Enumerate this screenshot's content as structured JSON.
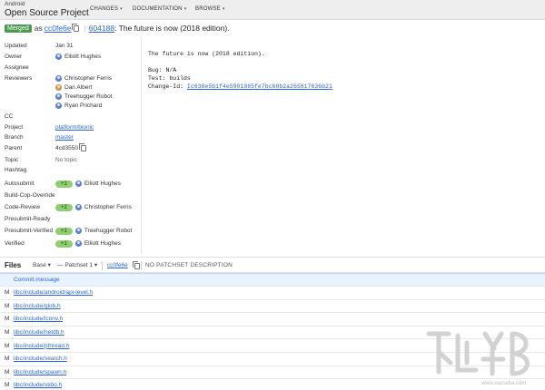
{
  "header": {
    "brand_small": "Android",
    "brand_big": "Open Source Project",
    "nav": [
      {
        "label": "CHANGES"
      },
      {
        "label": "DOCUMENTATION"
      },
      {
        "label": "BROWSE"
      }
    ],
    "nav_caret": "▾"
  },
  "change": {
    "status": "Merged",
    "as_text": "as",
    "commit_short": "cc0fe6e",
    "number": "604188",
    "subject": ": The future is now (2018 edition)."
  },
  "info": {
    "updated": {
      "label": "Updated",
      "value": "Jan 31"
    },
    "owner": {
      "label": "Owner",
      "value": "Elliott Hughes"
    },
    "assignee": {
      "label": "Assignee"
    },
    "reviewers": {
      "label": "Reviewers",
      "values": [
        "Christopher Ferris",
        "Dan Albert",
        "Treehugger Robot",
        "Ryan Prichard"
      ]
    },
    "cc": {
      "label": "CC"
    },
    "project": {
      "label": "Project",
      "value": "platform/bionic"
    },
    "branch": {
      "label": "Branch",
      "value": "master"
    },
    "parent": {
      "label": "Parent",
      "value": "4cd3550"
    },
    "topic": {
      "label": "Topic",
      "value": "No topic"
    },
    "hashtag": {
      "label": "Hashtag"
    },
    "autosubmit": {
      "label": "Autosubmit",
      "vote": "+1",
      "who": "Elliott Hughes"
    },
    "build_cop": {
      "label": "Build-Cop-Override"
    },
    "code_review": {
      "label": "Code-Review",
      "vote": "+2",
      "who": "Christopher Ferris"
    },
    "presubmit_ready": {
      "label": "Presubmit-Ready"
    },
    "presubmit_verified": {
      "label": "Presubmit-Verified",
      "vote": "+1",
      "who": "Treehugger Robot"
    },
    "verified": {
      "label": "Verified",
      "vote": "+1",
      "who": "Elliott Hughes"
    }
  },
  "commit_message": {
    "subject": "The future is now (2018 edition).",
    "bug": "Bug: N/A",
    "test": "Test: builds",
    "change_id_label": "Change-Id: ",
    "change_id": "Ic638e5b1f4e5901885fe7bc60b2a265817636b21"
  },
  "files": {
    "title": "Files",
    "base": "Base",
    "base_caret": "▾",
    "patchset_dash": "—",
    "patchset": "Patchset 1",
    "patchset_caret": "▾",
    "commit_hash": "cc0fe6e",
    "patchset_desc": "NO PATCHSET DESCRIPTION",
    "commit_message_link": "Commit message",
    "items": [
      {
        "status": "M",
        "path": "libc/include/android/api-level.h"
      },
      {
        "status": "M",
        "path": "libc/include/glob.h"
      },
      {
        "status": "M",
        "path": "libc/include/iconv.h"
      },
      {
        "status": "M",
        "path": "libc/include/netdb.h"
      },
      {
        "status": "M",
        "path": "libc/include/pthread.h"
      },
      {
        "status": "M",
        "path": "libc/include/search.h"
      },
      {
        "status": "M",
        "path": "libc/include/spawn.h"
      },
      {
        "status": "M",
        "path": "libc/include/stdio.h"
      }
    ]
  },
  "watermark": {
    "url": "www.xiazaiba.com"
  },
  "colors": {
    "merged": "#4c9a4f",
    "link": "#2a66d9",
    "vote": "#8fcf6e",
    "header_bg": "#eeeeee"
  }
}
